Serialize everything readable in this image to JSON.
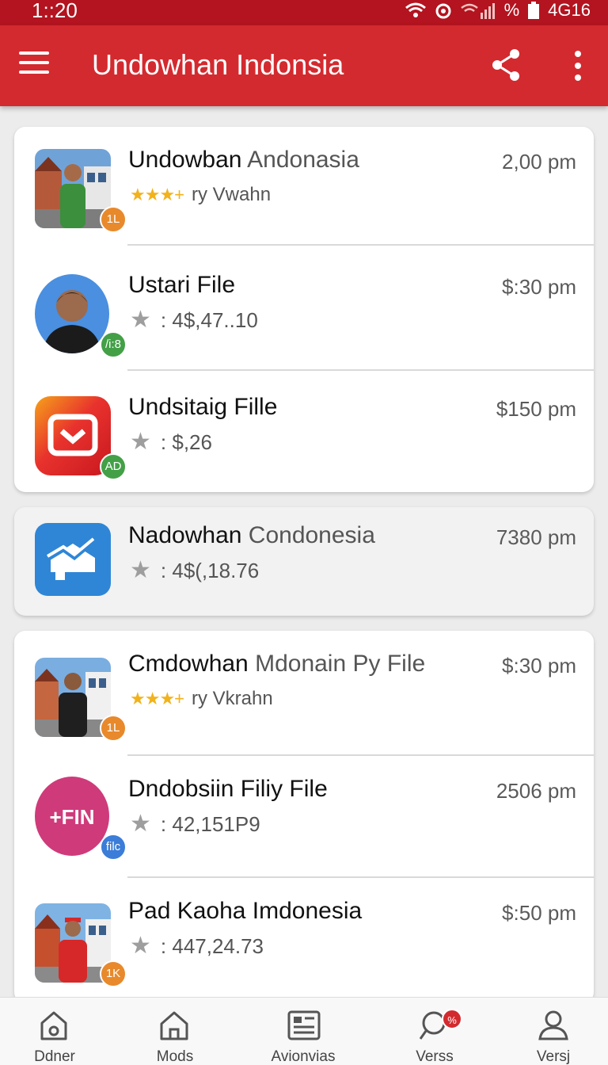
{
  "status_bar": {
    "time": "1::20",
    "battery_text": "%",
    "network_text": "4G16"
  },
  "app_bar": {
    "title": "Undowhan Indonsia",
    "menu_icon": "menu-icon",
    "share_icon": "share-icon",
    "more_icon": "more-vert-icon"
  },
  "lists": [
    {
      "items": [
        {
          "title_bold": "Undowban ",
          "title_light": "Andonasia",
          "time": "2,00 pm",
          "rating_style": "gold",
          "stars": "★★★+",
          "meta": "ry Vwahn",
          "badge": "1L",
          "badge_color": "#e8892b",
          "avatar": "photo-street"
        },
        {
          "title_bold": "Ustari File",
          "title_light": "",
          "time": "$:30 pm",
          "rating_style": "grey",
          "stars": "★",
          "meta": ": 4$,47..10",
          "badge": "/i:8",
          "badge_color": "#43a047",
          "avatar": "photo-portrait"
        },
        {
          "title_bold": "Undsitaig Fille",
          "title_light": "",
          "time": "$150 pm",
          "rating_style": "grey",
          "stars": "★",
          "meta": ": $,26",
          "badge": "AD",
          "badge_color": "#43a047",
          "avatar": "app-red"
        }
      ]
    },
    {
      "items": [
        {
          "title_bold": "Nadowhan ",
          "title_light": "Condonesia",
          "time": "7380 pm",
          "rating_style": "grey",
          "stars": "★",
          "meta": ": 4$(,18.76",
          "badge": "",
          "badge_color": "",
          "avatar": "app-blue"
        }
      ]
    },
    {
      "items": [
        {
          "title_bold": "Cmdowhan ",
          "title_light": "Mdonain Py File",
          "time": "$:30 pm",
          "rating_style": "gold",
          "stars": "★★★+",
          "meta": "ry Vkrahn",
          "badge": "1L",
          "badge_color": "#e8892b",
          "avatar": "photo-street-2"
        },
        {
          "title_bold": "Dndobsiin Filiy File",
          "title_light": "",
          "time": "2506 pm",
          "rating_style": "grey",
          "stars": "★",
          "meta": ": 42,151P9",
          "badge": "filc",
          "badge_color": "#3b7dd8",
          "avatar": "app-pink"
        },
        {
          "title_bold": "Pad Kaoha Imdonesia",
          "title_light": "",
          "time": "$:50 pm",
          "rating_style": "grey",
          "stars": "★",
          "meta": ": 447,24.73",
          "badge": "1K",
          "badge_color": "#e8892b",
          "avatar": "photo-street-3"
        }
      ]
    }
  ],
  "app_icon_text": {
    "pink": "+FIN"
  },
  "bottom_nav": [
    {
      "label": "Ddner",
      "icon": "home-outline-icon"
    },
    {
      "label": "Mods",
      "icon": "home-icon"
    },
    {
      "label": "Avionvias",
      "icon": "news-icon"
    },
    {
      "label": "Verss",
      "icon": "search-icon",
      "badge": "%"
    },
    {
      "label": "Versj",
      "icon": "profile-icon"
    }
  ],
  "colors": {
    "primary": "#d32a2f",
    "status_bar": "#b3141f",
    "star_gold": "#f2b21b"
  }
}
